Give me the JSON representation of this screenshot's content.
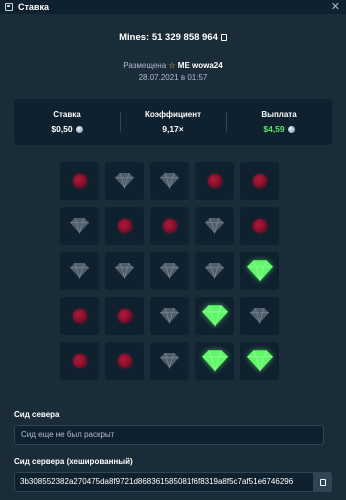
{
  "window": {
    "title": "Ставка",
    "close_glyph": "✕",
    "icon": "receipt-icon"
  },
  "header": {
    "headline": "Mines: 51 329 858 964",
    "posted_prefix": "Размещена",
    "user": "ME wowa24",
    "datetime": "28.07.2021 в 01:57"
  },
  "stats": [
    {
      "label": "Ставка",
      "value": "$0,50",
      "coin": true,
      "color": "#ffffff"
    },
    {
      "label": "Коэффициент",
      "value": "9,17×",
      "coin": false,
      "color": "#ffffff"
    },
    {
      "label": "Выплата",
      "value": "$4,59",
      "coin": true,
      "color": "#5fe36b"
    }
  ],
  "board": {
    "rows": [
      [
        "mine",
        "gem",
        "gem",
        "mine",
        "mine"
      ],
      [
        "gem",
        "mine",
        "mine",
        "gem",
        "mine"
      ],
      [
        "gem",
        "gem",
        "gem",
        "gem",
        "gem-revealed"
      ],
      [
        "mine",
        "mine",
        "gem",
        "gem-revealed",
        "gem"
      ],
      [
        "mine",
        "mine",
        "gem",
        "gem-revealed",
        "gem-revealed"
      ]
    ],
    "colors": {
      "gem": "#4f5e6b",
      "gem_revealed": "#60f76a",
      "mine": "#8a1230"
    }
  },
  "seed_section": {
    "server_seed_label": "Сид севера",
    "server_seed_placeholder": "Сид еще не был раскрыт",
    "hashed_label": "Сид сервера (хешированный)",
    "hashed_value": "3b308552382a270475da8f9721d868361585081f6f8319a8f5c7af51e6746296"
  }
}
